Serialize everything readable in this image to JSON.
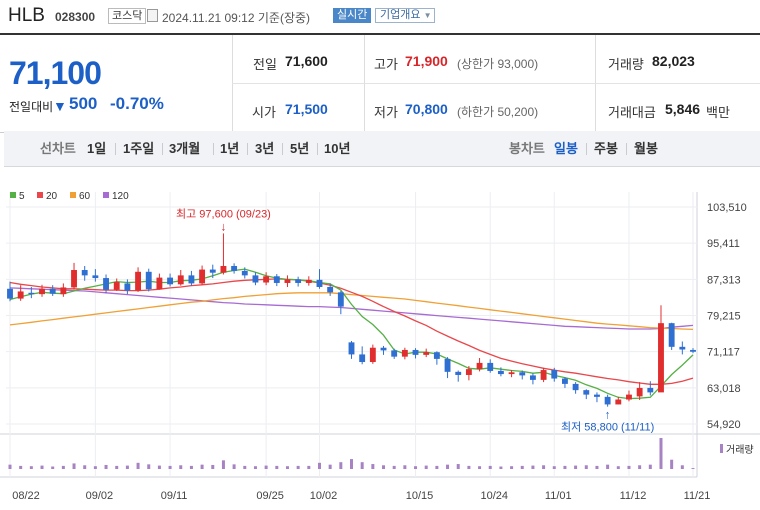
{
  "header": {
    "name": "HLB",
    "code": "028300",
    "market": "코스닥",
    "timestamp": "2024.11.21 09:12 기준(장중)",
    "realtime": "실시간",
    "company_info": "기업개요"
  },
  "summary": {
    "price": "71,100",
    "change_label": "전일대비",
    "change_direction": "down",
    "change": "500",
    "change_pct": "-0.70%",
    "prev_label": "전일",
    "prev": "71,600",
    "high_label": "고가",
    "high": "71,900",
    "upper_label": "(상한가 93,000)",
    "volume_label": "거래량",
    "volume": "82,023",
    "open_label": "시가",
    "open": "71,500",
    "low_label": "저가",
    "low": "70,800",
    "lower_label": "(하한가 50,200)",
    "amount_label": "거래대금",
    "amount": "5,846",
    "amount_unit": "백만"
  },
  "period_tabs": {
    "line_label": "선차트",
    "line": [
      "1일",
      "1주일",
      "3개월",
      "1년",
      "3년",
      "5년",
      "10년"
    ],
    "candle_label": "봉차트",
    "candle": [
      "일봉",
      "주봉",
      "월봉"
    ],
    "active": "일봉"
  },
  "chart_data": {
    "type": "candlestick",
    "legend": [
      "5",
      "20",
      "60",
      "120"
    ],
    "colors": {
      "up": "#e02d2d",
      "down": "#2f6fd1",
      "ma5": "#55b045",
      "ma20": "#e8474b",
      "ma60": "#f0a034",
      "ma120": "#a86ad3",
      "volume": "#a783c4"
    },
    "y_ticks": [
      "103,510",
      "95,411",
      "87,313",
      "79,215",
      "71,117",
      "63,018",
      "54,920"
    ],
    "ylim": [
      54920,
      103510
    ],
    "x_ticks": [
      "08/22",
      "09/02",
      "09/11",
      "09/25",
      "10/02",
      "10/15",
      "10/24",
      "11/01",
      "11/12",
      "11/21"
    ],
    "high_annotation": "최고 97,600 (09/23)",
    "low_annotation": "최저 58,800 (11/11)",
    "volume_label": "거래량",
    "candles": [
      [
        85200,
        83000,
        86800,
        82400
      ],
      [
        83000,
        84600,
        86000,
        82500
      ],
      [
        84300,
        84000,
        85600,
        83100
      ],
      [
        84000,
        85200,
        86100,
        83400
      ],
      [
        85200,
        84100,
        86000,
        83600
      ],
      [
        84000,
        85500,
        86400,
        83400
      ],
      [
        85500,
        89400,
        91000,
        85000
      ],
      [
        89400,
        88200,
        90300,
        87000
      ],
      [
        88200,
        87600,
        89600,
        86800
      ],
      [
        87600,
        85000,
        88400,
        84200
      ],
      [
        85000,
        86700,
        87500,
        84700
      ],
      [
        86400,
        84800,
        87300,
        84000
      ],
      [
        84800,
        89000,
        90000,
        84500
      ],
      [
        89000,
        85100,
        89700,
        84600
      ],
      [
        85100,
        87700,
        88600,
        85000
      ],
      [
        87700,
        86200,
        88600,
        85700
      ],
      [
        86200,
        88200,
        89400,
        85900
      ],
      [
        88200,
        86400,
        89200,
        85900
      ],
      [
        86400,
        89500,
        90400,
        86100
      ],
      [
        89500,
        88800,
        90600,
        87600
      ],
      [
        88800,
        90300,
        97600,
        88400
      ],
      [
        90300,
        89200,
        90900,
        88600
      ],
      [
        89200,
        88200,
        90000,
        87500
      ],
      [
        88200,
        86600,
        88900,
        86000
      ],
      [
        86600,
        88000,
        88900,
        86000
      ],
      [
        88000,
        86500,
        88500,
        85800
      ],
      [
        86500,
        87300,
        88200,
        85600
      ],
      [
        87300,
        86500,
        87900,
        85700
      ],
      [
        86500,
        87200,
        88000,
        85900
      ],
      [
        87200,
        85600,
        89600,
        85200
      ],
      [
        85600,
        84400,
        86400,
        83600
      ],
      [
        84400,
        81200,
        84700,
        79500
      ],
      [
        73200,
        70500,
        73500,
        69500
      ],
      [
        70500,
        68800,
        72300,
        68300
      ],
      [
        68800,
        72000,
        72700,
        68400
      ],
      [
        72000,
        71400,
        72400,
        70400
      ],
      [
        71400,
        70000,
        71800,
        69500
      ],
      [
        70000,
        71500,
        72000,
        69400
      ],
      [
        71500,
        70400,
        71900,
        69600
      ],
      [
        70400,
        71000,
        71800,
        69900
      ],
      [
        71000,
        69500,
        71200,
        68200
      ],
      [
        69500,
        66600,
        69900,
        65200
      ],
      [
        66600,
        65900,
        66900,
        64400
      ],
      [
        65900,
        67200,
        67900,
        64700
      ],
      [
        67200,
        68600,
        69700,
        66700
      ],
      [
        68600,
        66800,
        69400,
        66400
      ],
      [
        66800,
        66100,
        67600,
        65600
      ],
      [
        66100,
        66500,
        67000,
        65400
      ],
      [
        66500,
        65800,
        66900,
        64900
      ],
      [
        65800,
        64800,
        66300,
        63800
      ],
      [
        64800,
        67000,
        67500,
        64300
      ],
      [
        67000,
        65100,
        67500,
        64400
      ],
      [
        65100,
        63900,
        65400,
        63000
      ],
      [
        63900,
        62500,
        64300,
        61700
      ],
      [
        62500,
        61500,
        62700,
        60500
      ],
      [
        61500,
        61000,
        62000,
        59800
      ],
      [
        61000,
        59300,
        61500,
        58800
      ],
      [
        59300,
        60400,
        61000,
        59300
      ],
      [
        60400,
        61500,
        62400,
        60000
      ],
      [
        61100,
        63000,
        64300,
        60300
      ],
      [
        63000,
        62000,
        64500,
        61300
      ],
      [
        62000,
        77500,
        81500,
        62800
      ],
      [
        77500,
        72200,
        77600,
        71500
      ],
      [
        72200,
        71600,
        73400,
        70500
      ],
      [
        71500,
        71100,
        71900,
        70800
      ]
    ],
    "ma5": [
      82800,
      83400,
      84000,
      84400,
      84200,
      84100,
      84700,
      85300,
      85800,
      86300,
      86800,
      86600,
      86700,
      86900,
      86600,
      86600,
      87000,
      87100,
      87400,
      88100,
      88900,
      89300,
      89600,
      88900,
      88100,
      87600,
      87300,
      87200,
      87000,
      86600,
      86300,
      84900,
      81700,
      79000,
      77200,
      74800,
      71500,
      70600,
      71000,
      71000,
      70600,
      69500,
      68500,
      67400,
      67200,
      67500,
      67200,
      66900,
      66700,
      66300,
      66500,
      65800,
      65300,
      64700,
      63700,
      62900,
      61800,
      60900,
      60600,
      60700,
      60900,
      63400,
      66000,
      68100,
      70400
    ],
    "ma20": [
      86600,
      86200,
      85900,
      85600,
      85400,
      85200,
      85200,
      85100,
      85000,
      84900,
      84900,
      84800,
      84800,
      84900,
      85100,
      85400,
      85600,
      85900,
      86100,
      86300,
      86600,
      86900,
      87100,
      87200,
      87300,
      87400,
      87300,
      87200,
      86900,
      86500,
      86000,
      85300,
      84400,
      83500,
      82400,
      81200,
      80100,
      79100,
      78000,
      77000,
      75700,
      74600,
      73500,
      72500,
      71400,
      70500,
      69600,
      69000,
      68400,
      67900,
      67400,
      67000,
      66600,
      66300,
      65900,
      65500,
      65100,
      64800,
      64400,
      64100,
      63800,
      63800,
      64000,
      64500,
      65200
    ],
    "ma60": [
      77100,
      77400,
      77700,
      78000,
      78300,
      78600,
      78900,
      79200,
      79500,
      79800,
      80100,
      80400,
      80700,
      81000,
      81300,
      81600,
      81900,
      82200,
      82400,
      82700,
      83000,
      83200,
      83500,
      83700,
      83900,
      84100,
      84200,
      84300,
      84300,
      84300,
      84300,
      84100,
      83900,
      83700,
      83500,
      83300,
      83100,
      82900,
      82600,
      82300,
      82000,
      81700,
      81400,
      81100,
      80800,
      80500,
      80200,
      79900,
      79600,
      79300,
      79000,
      78700,
      78400,
      78100,
      77800,
      77500,
      77300,
      77100,
      76900,
      76700,
      76500,
      76400,
      76300,
      76200,
      76100
    ],
    "ma120": [
      85400,
      85300,
      85200,
      85100,
      85000,
      84900,
      84800,
      84700,
      84500,
      84300,
      84100,
      83900,
      83700,
      83500,
      83300,
      83100,
      82900,
      82700,
      82500,
      82300,
      82100,
      82000,
      81800,
      81700,
      81600,
      81500,
      81400,
      81300,
      81200,
      81200,
      81100,
      81000,
      80800,
      80600,
      80400,
      80200,
      80000,
      79800,
      79600,
      79400,
      79200,
      79000,
      78800,
      78600,
      78400,
      78200,
      78000,
      77800,
      77600,
      77400,
      77200,
      77000,
      76800,
      76700,
      76600,
      76500,
      76400,
      76300,
      76200,
      76200,
      76200,
      76300,
      76600,
      76800,
      77000
    ],
    "volume": [
      0.14,
      0.1,
      0.09,
      0.11,
      0.08,
      0.1,
      0.18,
      0.12,
      0.09,
      0.13,
      0.1,
      0.11,
      0.2,
      0.15,
      0.11,
      0.1,
      0.12,
      0.1,
      0.14,
      0.13,
      0.28,
      0.15,
      0.1,
      0.09,
      0.11,
      0.1,
      0.09,
      0.1,
      0.1,
      0.2,
      0.14,
      0.22,
      0.32,
      0.22,
      0.16,
      0.12,
      0.1,
      0.12,
      0.09,
      0.11,
      0.1,
      0.14,
      0.16,
      0.1,
      0.09,
      0.1,
      0.08,
      0.09,
      0.1,
      0.11,
      0.12,
      0.09,
      0.1,
      0.11,
      0.12,
      0.1,
      0.14,
      0.09,
      0.1,
      0.12,
      0.14,
      1.0,
      0.3,
      0.12,
      0.03
    ]
  }
}
